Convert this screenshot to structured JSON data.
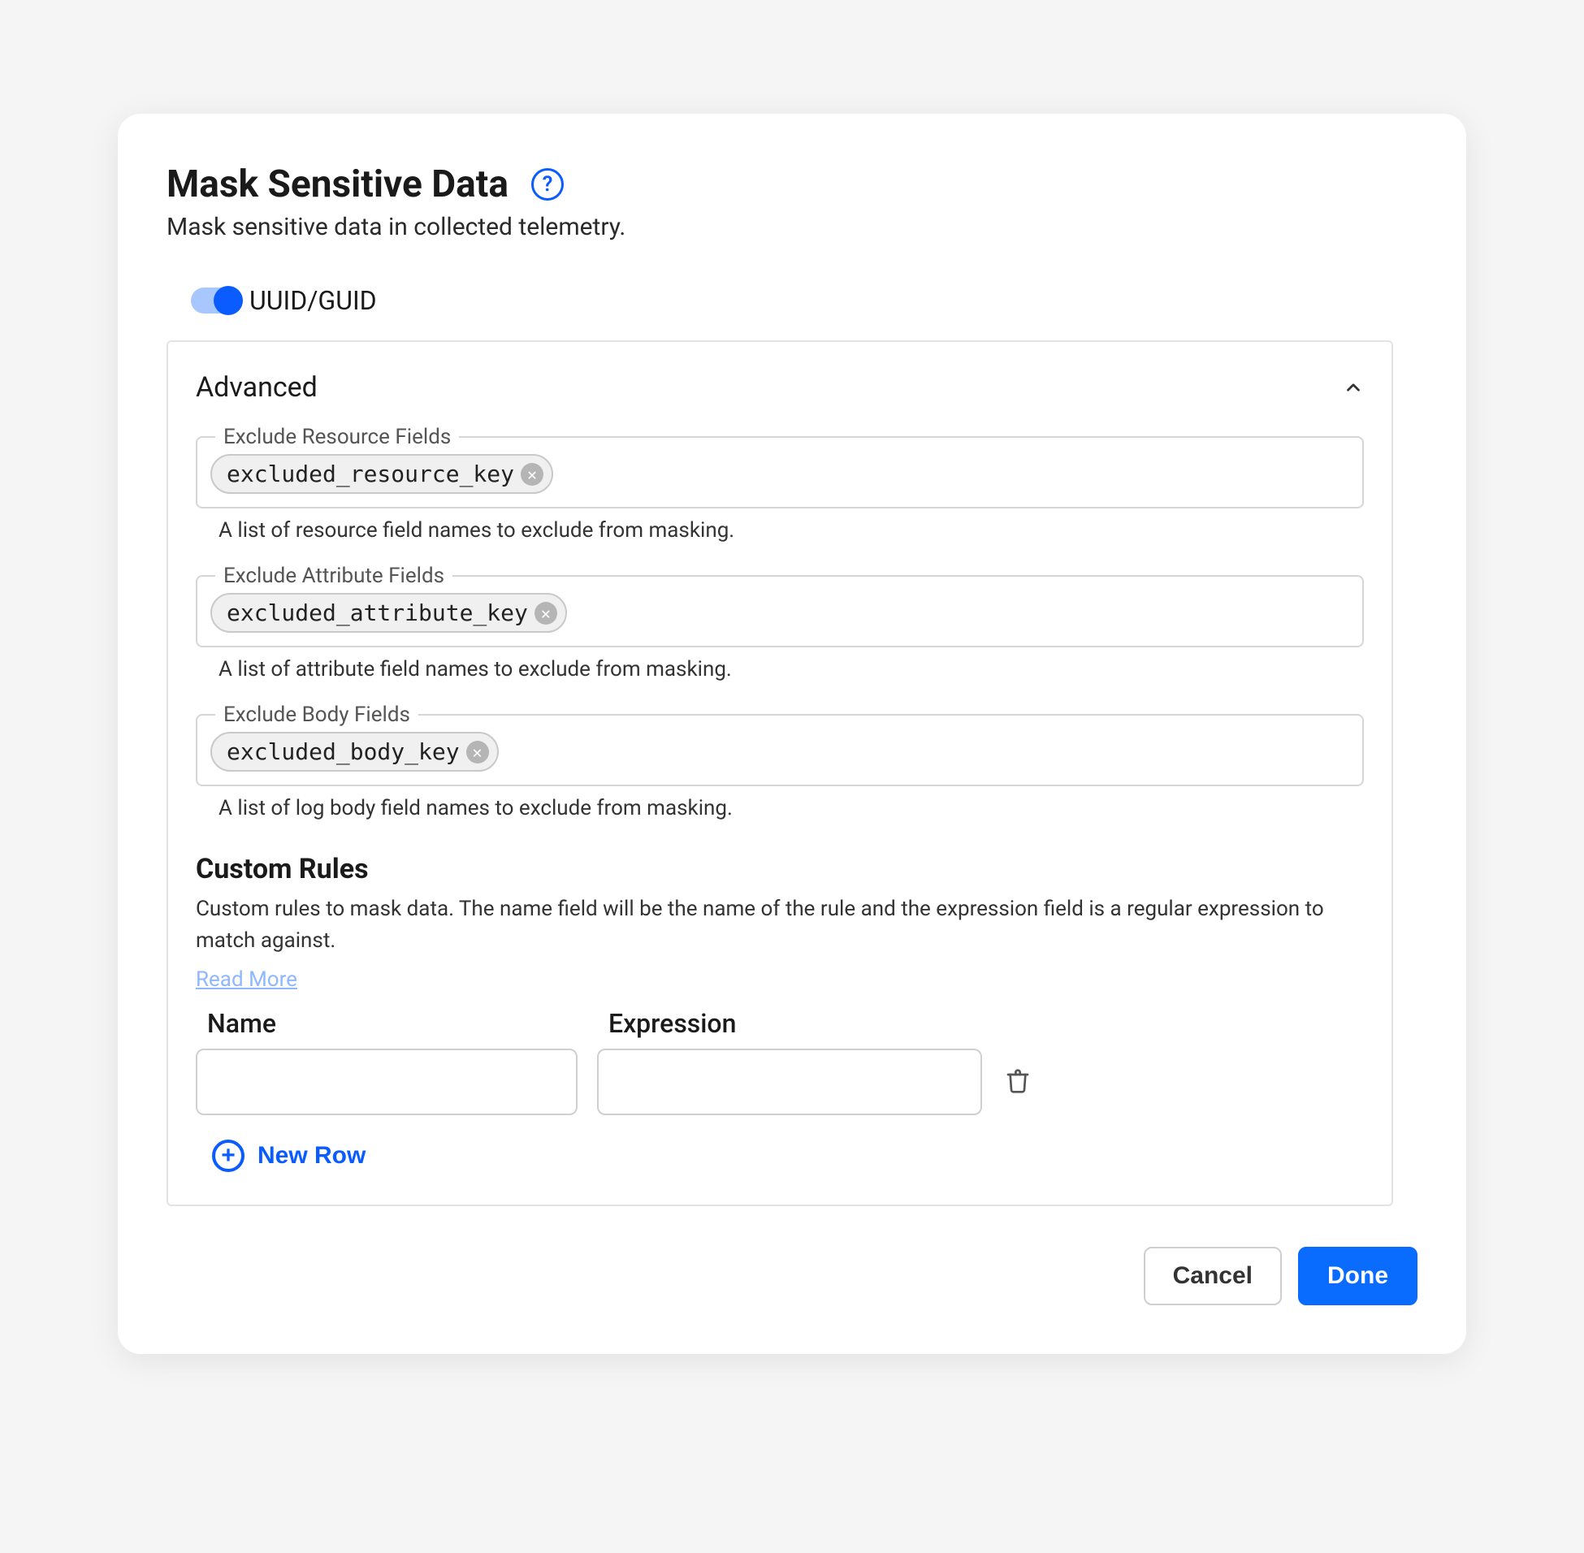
{
  "header": {
    "title": "Mask Sensitive Data",
    "subtitle": "Mask sensitive data in collected telemetry."
  },
  "toggle": {
    "label": "UUID/GUID",
    "value": true
  },
  "advanced": {
    "title": "Advanced",
    "exclude_resource": {
      "label": "Exclude Resource Fields",
      "chip": "excluded_resource_key",
      "help": "A list of resource field names to exclude from masking."
    },
    "exclude_attribute": {
      "label": "Exclude Attribute Fields",
      "chip": "excluded_attribute_key",
      "help": "A list of attribute field names to exclude from masking."
    },
    "exclude_body": {
      "label": "Exclude Body Fields",
      "chip": "excluded_body_key",
      "help": "A list of log body field names to exclude from masking."
    }
  },
  "custom_rules": {
    "title": "Custom Rules",
    "description": "Custom rules to mask data. The name field will be the name of the rule and the expression field is a regular expression to match against.",
    "read_more": "Read More",
    "headers": {
      "name": "Name",
      "expression": "Expression"
    },
    "row": {
      "name": "",
      "expression": ""
    },
    "new_row": "New Row"
  },
  "footer": {
    "cancel": "Cancel",
    "done": "Done"
  }
}
